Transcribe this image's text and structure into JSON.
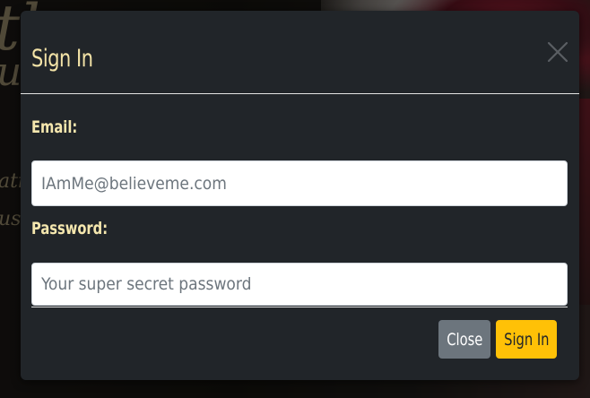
{
  "background": {
    "script_lines": [
      "th",
      "ui",
      "ati",
      "us"
    ]
  },
  "modal": {
    "title": "Sign In",
    "close_icon": "close-x-icon",
    "email": {
      "label": "Email:",
      "value": "",
      "placeholder": "IAmMe@believeme.com"
    },
    "password": {
      "label": "Password:",
      "value": "",
      "placeholder": "Your super secret password"
    },
    "buttons": {
      "close_label": "Close",
      "signin_label": "Sign In"
    }
  },
  "colors": {
    "modal_bg": "#212529",
    "title_color": "#f3e3a7",
    "label_color": "#f5e7ae",
    "close_button": "#6c757d",
    "signin_button": "#ffc107"
  }
}
